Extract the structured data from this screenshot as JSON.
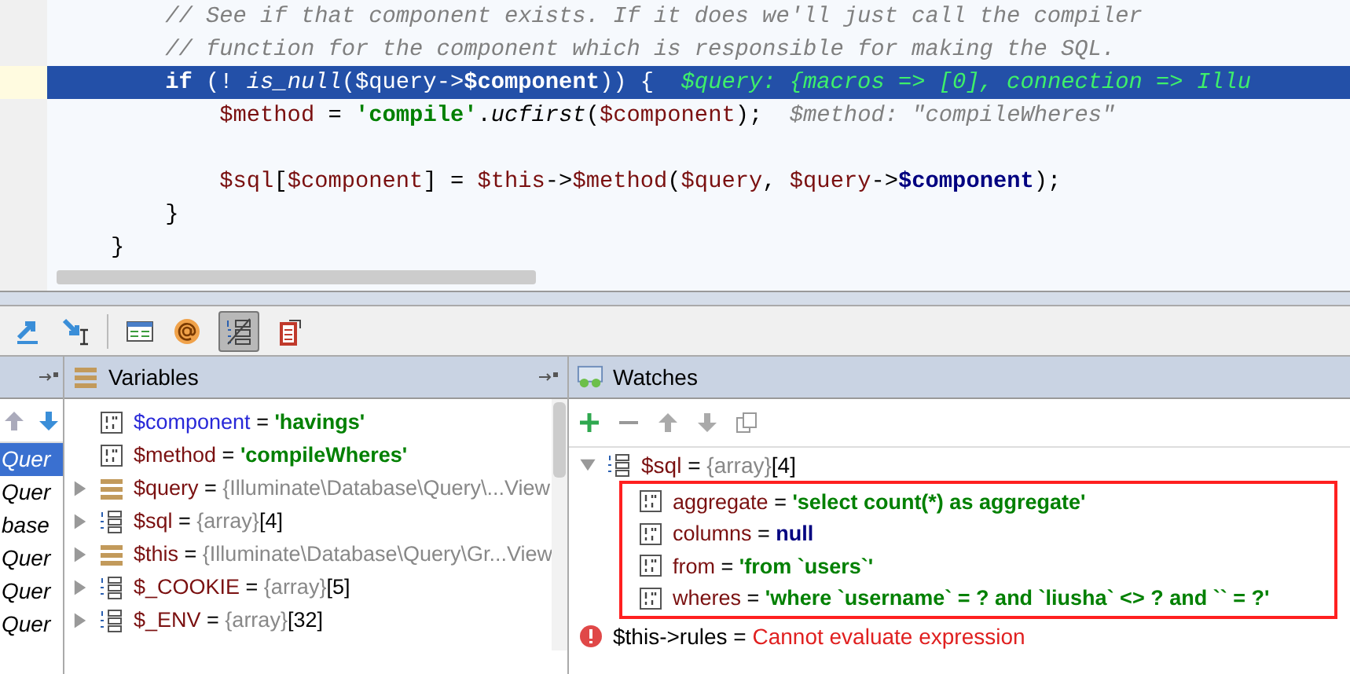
{
  "editor": {
    "lines": [
      {
        "highlighted": false,
        "segments": [
          {
            "text": "        // See if that component exists. If it does we'll just call the compiler",
            "kind": "comment"
          }
        ]
      },
      {
        "highlighted": false,
        "segments": [
          {
            "text": "        // function for the component which is responsible for making the SQL.",
            "kind": "comment"
          }
        ]
      },
      {
        "highlighted": true,
        "segments": [
          {
            "text": "        if",
            "kind": "keyword"
          },
          {
            "text": " (! ",
            "kind": "plain"
          },
          {
            "text": "is_null",
            "kind": "func"
          },
          {
            "text": "(",
            "kind": "plain"
          },
          {
            "text": "$query",
            "kind": "var"
          },
          {
            "text": "->",
            "kind": "plain"
          },
          {
            "text": "$component",
            "kind": "prop"
          },
          {
            "text": ")) {  ",
            "kind": "plain"
          },
          {
            "text": "$query: {macros => [0], connection => Illu",
            "kind": "hint"
          }
        ]
      },
      {
        "highlighted": false,
        "segments": [
          {
            "text": "            $method",
            "kind": "var"
          },
          {
            "text": " = ",
            "kind": "plain"
          },
          {
            "text": "'compile'",
            "kind": "string"
          },
          {
            "text": ".",
            "kind": "plain"
          },
          {
            "text": "ucfirst",
            "kind": "func"
          },
          {
            "text": "(",
            "kind": "plain"
          },
          {
            "text": "$component",
            "kind": "var"
          },
          {
            "text": ");  ",
            "kind": "plain"
          },
          {
            "text": "$method: \"compileWheres\"",
            "kind": "hint"
          }
        ]
      },
      {
        "highlighted": false
      },
      {
        "highlighted": false,
        "segments": [
          {
            "text": "            $sql",
            "kind": "var"
          },
          {
            "text": "[",
            "kind": "plain"
          },
          {
            "text": "$component",
            "kind": "var"
          },
          {
            "text": "] = ",
            "kind": "plain"
          },
          {
            "text": "$this",
            "kind": "var"
          },
          {
            "text": "->",
            "kind": "plain"
          },
          {
            "text": "$method",
            "kind": "var"
          },
          {
            "text": "(",
            "kind": "plain"
          },
          {
            "text": "$query",
            "kind": "var"
          },
          {
            "text": ", ",
            "kind": "plain"
          },
          {
            "text": "$query",
            "kind": "var"
          },
          {
            "text": "->",
            "kind": "plain"
          },
          {
            "text": "$component",
            "kind": "prop"
          },
          {
            "text": ");",
            "kind": "plain"
          }
        ]
      },
      {
        "highlighted": false,
        "segments": [
          {
            "text": "        }",
            "kind": "plain"
          }
        ]
      },
      {
        "highlighted": false,
        "segments": [
          {
            "text": "    }",
            "kind": "plain"
          }
        ]
      }
    ]
  },
  "frames": {
    "items": [
      {
        "label": "Quer",
        "selected": true
      },
      {
        "label": "Quer",
        "selected": false
      },
      {
        "label": "base",
        "selected": false
      },
      {
        "label": "Quer",
        "selected": false
      },
      {
        "label": "Quer",
        "selected": false
      },
      {
        "label": "Quer",
        "selected": false
      }
    ]
  },
  "variables": {
    "title": "Variables",
    "rows": [
      {
        "kind": "field",
        "expandable": false,
        "parameter": true,
        "name": "$component",
        "operator": "=",
        "value": [
          {
            "text": "'havings'",
            "kind": "string"
          }
        ]
      },
      {
        "kind": "field",
        "expandable": false,
        "parameter": false,
        "name": "$method",
        "operator": "=",
        "value": [
          {
            "text": "'compileWheres'",
            "kind": "string"
          }
        ]
      },
      {
        "kind": "object",
        "expandable": true,
        "parameter": false,
        "name": "$query",
        "operator": "=",
        "value": [
          {
            "text": "{Illuminate\\Database\\Query\\...",
            "kind": "type"
          },
          {
            "text": "View",
            "kind": "link"
          }
        ]
      },
      {
        "kind": "array",
        "expandable": true,
        "parameter": false,
        "name": "$sql",
        "operator": "=",
        "value": [
          {
            "text": "{array}",
            "kind": "type"
          },
          {
            "text": "[4]",
            "kind": "count"
          }
        ]
      },
      {
        "kind": "object",
        "expandable": true,
        "parameter": false,
        "name": "$this",
        "operator": "=",
        "value": [
          {
            "text": "{Illuminate\\Database\\Query\\Gr...",
            "kind": "type"
          },
          {
            "text": "View",
            "kind": "link"
          }
        ]
      },
      {
        "kind": "array",
        "expandable": true,
        "parameter": false,
        "name": "$_COOKIE",
        "operator": "=",
        "value": [
          {
            "text": "{array}",
            "kind": "type"
          },
          {
            "text": "[5]",
            "kind": "count"
          }
        ]
      },
      {
        "kind": "array",
        "expandable": true,
        "parameter": false,
        "name": "$_ENV",
        "operator": "=",
        "value": [
          {
            "text": "{array}",
            "kind": "type"
          },
          {
            "text": "[32]",
            "kind": "count"
          }
        ]
      }
    ]
  },
  "watches": {
    "title": "Watches",
    "root": {
      "name": "$sql",
      "operator": "=",
      "expanded": true,
      "value": [
        {
          "text": "{array}",
          "kind": "type"
        },
        {
          "text": "[4]",
          "kind": "count"
        }
      ],
      "children": [
        {
          "name": "aggregate",
          "operator": "=",
          "value": [
            {
              "text": "'select count(*) as aggregate'",
              "kind": "string"
            }
          ]
        },
        {
          "name": "columns",
          "operator": "=",
          "value": [
            {
              "text": "null",
              "kind": "null"
            }
          ]
        },
        {
          "name": "from",
          "operator": "=",
          "value": [
            {
              "text": "'from `users`'",
              "kind": "string"
            }
          ]
        },
        {
          "name": "wheres",
          "operator": "=",
          "value": [
            {
              "text": "'where `username` = ? and `liusha` <> ? and `` = ?'",
              "kind": "string"
            }
          ]
        }
      ]
    },
    "error": {
      "name": "$this->rules",
      "operator": "=",
      "message": "Cannot evaluate expression"
    }
  }
}
